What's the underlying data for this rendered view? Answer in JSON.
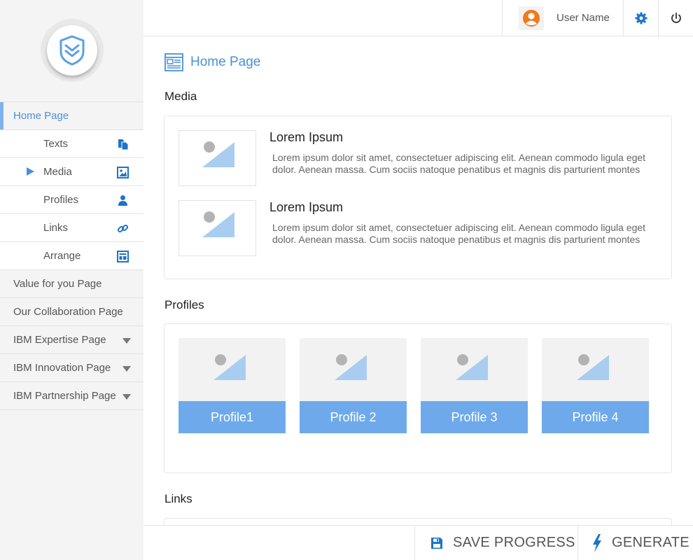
{
  "sidebar": {
    "items": [
      {
        "label": "Home Page"
      },
      {
        "label": "Texts"
      },
      {
        "label": "Media"
      },
      {
        "label": "Profiles"
      },
      {
        "label": "Links"
      },
      {
        "label": "Arrange"
      },
      {
        "label": "Value for you Page"
      },
      {
        "label": "Our Collaboration Page"
      },
      {
        "label": "IBM Expertise Page"
      },
      {
        "label": "IBM Innovation Page"
      },
      {
        "label": "IBM Partnership Page"
      }
    ]
  },
  "topbar": {
    "user_name": "User Name"
  },
  "main": {
    "page_title": "Home Page",
    "sections": {
      "media": "Media",
      "profiles": "Profiles",
      "links": "Links"
    },
    "media_items": [
      {
        "title": "Lorem Ipsum",
        "desc": "Lorem ipsum dolor sit amet, consectetuer adipiscing elit. Aenean commodo ligula eget dolor. Aenean massa. Cum sociis natoque penatibus et magnis dis parturient montes"
      },
      {
        "title": "Lorem Ipsum",
        "desc": "Lorem ipsum dolor sit amet, consectetuer adipiscing elit. Aenean commodo ligula eget dolor. Aenean massa. Cum sociis natoque penatibus et magnis dis parturient montes"
      }
    ],
    "profiles": [
      {
        "label": "Profile1"
      },
      {
        "label": "Profile 2"
      },
      {
        "label": "Profile 3"
      },
      {
        "label": "Profile 4"
      }
    ]
  },
  "bottombar": {
    "save_label": "SAVE PROGRESS",
    "generate_label": "GENERATE"
  },
  "colors": {
    "accent": "#4a90d9",
    "profile_label_bg": "#6eaaeb",
    "placeholder_triangle": "#a9cdf0",
    "placeholder_dot": "#b3b3b3"
  }
}
